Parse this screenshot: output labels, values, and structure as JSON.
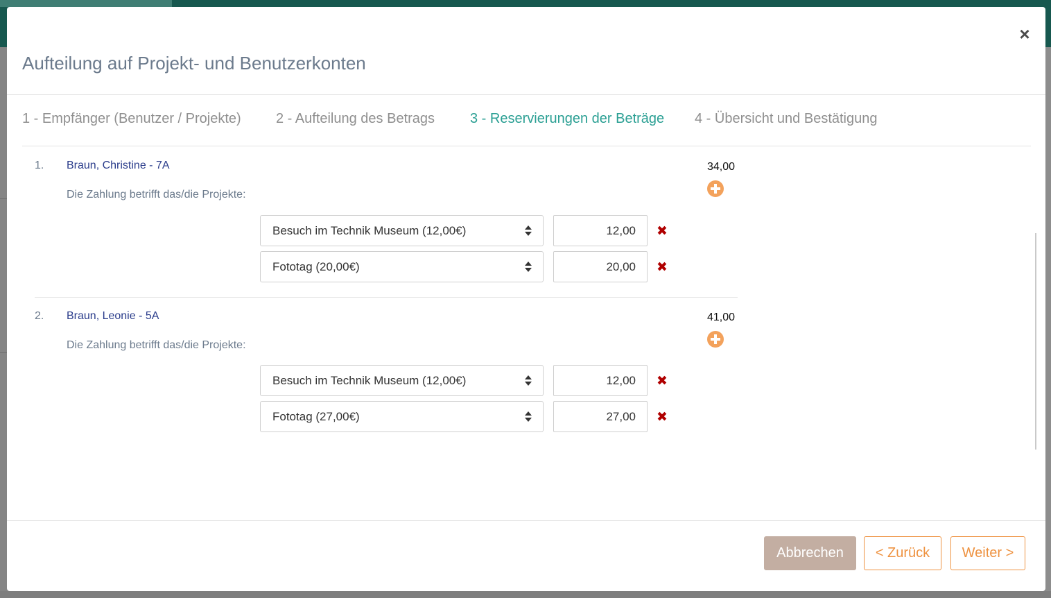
{
  "dialog": {
    "title": "Aufteilung auf Projekt- und Benutzerkonten",
    "close_symbol": "×"
  },
  "steps": [
    {
      "label": "1 - Empfänger (Benutzer / Projekte)",
      "active": false
    },
    {
      "label": "2 - Aufteilung des Betrags",
      "active": false
    },
    {
      "label": "3 - Reservierungen der Beträge",
      "active": true
    },
    {
      "label": "4 - Übersicht und Bestätigung",
      "active": false
    }
  ],
  "recipients": [
    {
      "number": "1.",
      "name": "Braun, Christine - 7A",
      "amount": "34,00",
      "description": "Die Zahlung betrifft das/die Projekte:",
      "projects": [
        {
          "project": "Besuch im Technik Museum (12,00€)",
          "amount": "12,00"
        },
        {
          "project": "Fototag (20,00€)",
          "amount": "20,00"
        }
      ]
    },
    {
      "number": "2.",
      "name": "Braun, Leonie - 5A",
      "amount": "41,00",
      "description": "Die Zahlung betrifft das/die Projekte:",
      "projects": [
        {
          "project": "Besuch im Technik Museum (12,00€)",
          "amount": "12,00"
        },
        {
          "project": "Fototag (27,00€)",
          "amount": "27,00"
        }
      ]
    }
  ],
  "footer": {
    "cancel_label": "Abbrechen",
    "back_label": "< Zurück",
    "next_label": "Weiter >"
  },
  "colors": {
    "active_step": "#2a9f93",
    "recipient_name": "#2a3c8b",
    "accent_orange": "#ee9240",
    "cancel_button": "#c3aea2",
    "delete_red": "#b00000"
  },
  "icons": {
    "close": "close-icon",
    "add": "plus-circle-icon",
    "delete": "cross-icon",
    "select_arrows": "sort-arrows-icon"
  }
}
